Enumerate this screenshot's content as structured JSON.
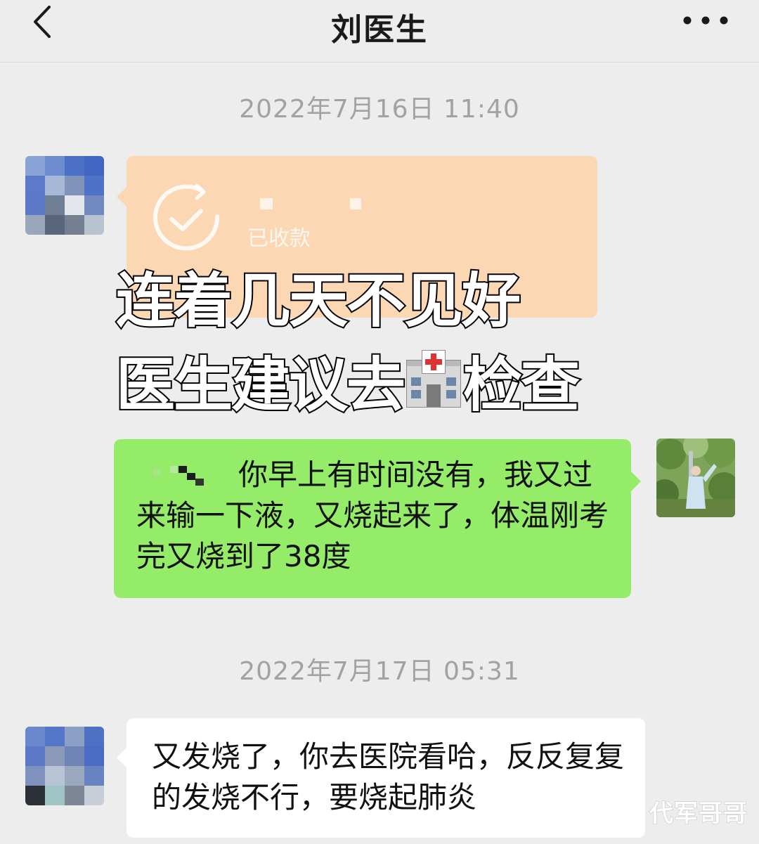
{
  "header": {
    "title": "刘医生",
    "back_icon": "chevron-left-icon",
    "more_icon": "more-dots-icon"
  },
  "messages": [
    {
      "timestamp": "2022年7月16日 11:40"
    },
    {
      "type": "transfer",
      "status": "已收款",
      "icon": "check-circle-icon",
      "color": "#fbd7b4"
    },
    {
      "type": "text",
      "direction": "sent",
      "text": "你早上有时间没有，我又过来输一下液，又烧起来了，体温刚考完又烧到了38度",
      "color": "#95ec69"
    },
    {
      "timestamp": "2022年7月17日 05:31"
    },
    {
      "type": "text",
      "direction": "received",
      "text": "又发烧了，你去医院看哈，反反复复的发烧不行，要烧起肺炎",
      "color": "#ffffff"
    }
  ],
  "overlay": {
    "line1": "连着几天不见好",
    "line2_before": "医生建议去",
    "line2_icon": "hospital-emoji",
    "line2_after": "检查"
  },
  "watermark": "代军哥哥"
}
